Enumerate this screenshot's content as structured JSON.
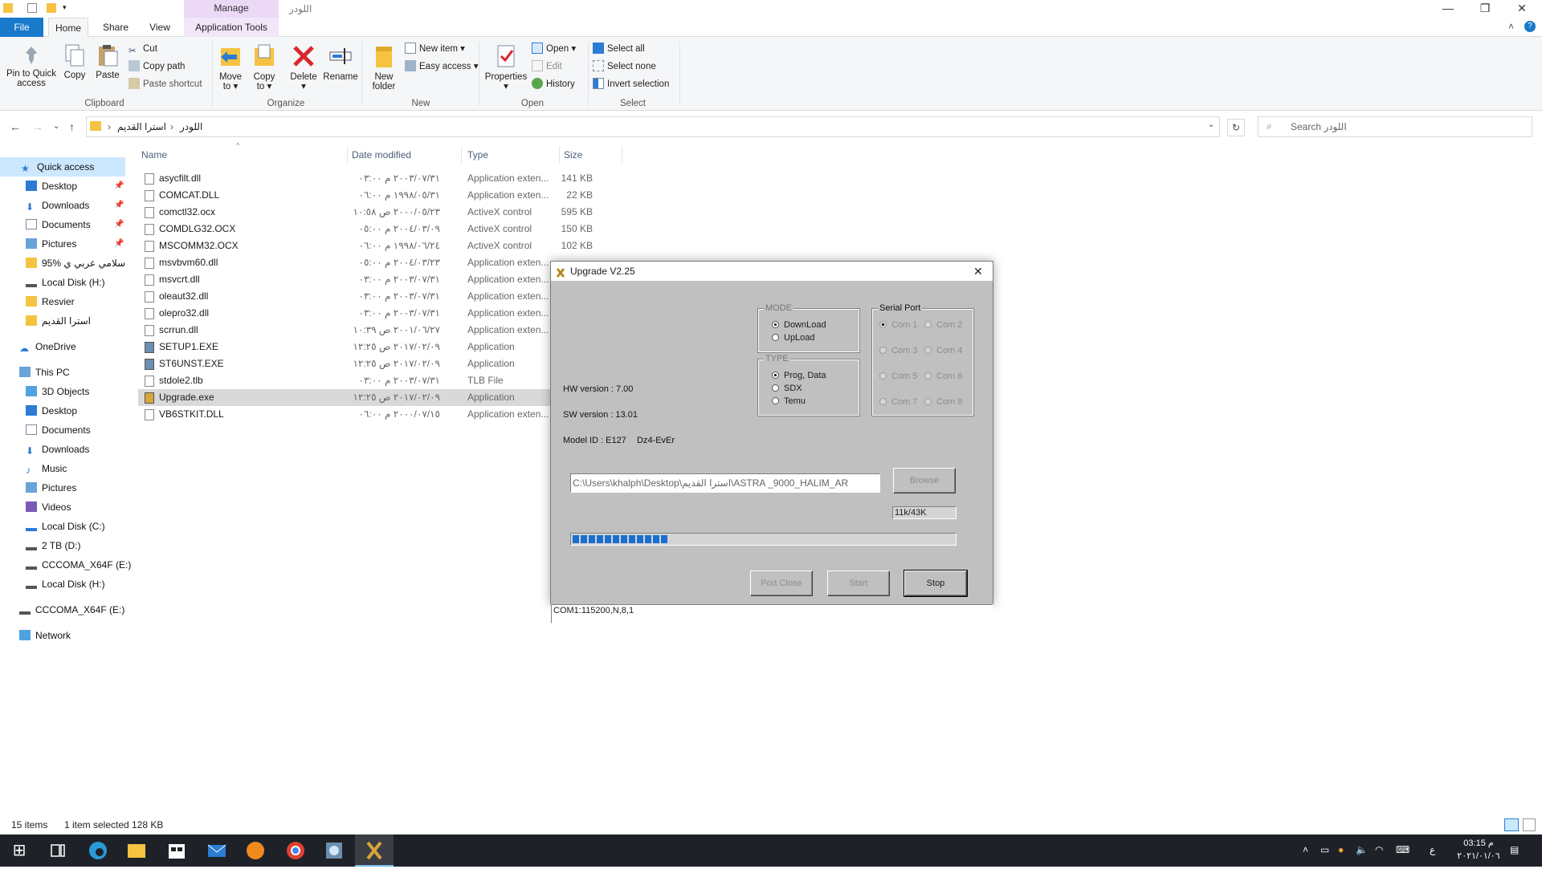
{
  "window": {
    "title": "اللودر",
    "manage_tab": "Manage",
    "controls": {
      "minimize": "—",
      "maximize": "❐",
      "close": "✕"
    }
  },
  "tabs": {
    "file": "File",
    "home": "Home",
    "share": "Share",
    "view": "View",
    "app_tools": "Application Tools",
    "right_chevron": "˄",
    "help": "?"
  },
  "ribbon": {
    "clipboard": {
      "pin": "Pin to Quick access",
      "copy": "Copy",
      "paste": "Paste",
      "cut": "Cut",
      "copy_path": "Copy path",
      "paste_shortcut": "Paste shortcut",
      "label": "Clipboard"
    },
    "organize": {
      "move_to": "Move to",
      "copy_to": "Copy to",
      "delete": "Delete",
      "rename": "Rename",
      "label": "Organize"
    },
    "new": {
      "new_folder": "New folder",
      "new_item": "New item",
      "easy_access": "Easy access",
      "label": "New"
    },
    "open": {
      "properties": "Properties",
      "open": "Open",
      "edit": "Edit",
      "history": "History",
      "label": "Open"
    },
    "select": {
      "select_all": "Select all",
      "select_none": "Select none",
      "invert": "Invert selection",
      "label": "Select"
    }
  },
  "address": {
    "path": [
      "استرا القديم",
      "اللودر"
    ],
    "search_placeholder": "Search اللودر"
  },
  "nav": {
    "quick_access": "Quick access",
    "items": [
      "Desktop",
      "Downloads",
      "Documents",
      "Pictures",
      "95% اسلامي عربي ي",
      "Local Disk (H:)",
      "Resvier",
      "استرا القديم"
    ],
    "onedrive": "OneDrive",
    "this_pc": "This PC",
    "pc_items": [
      "3D Objects",
      "Desktop",
      "Documents",
      "Downloads",
      "Music",
      "Pictures",
      "Videos",
      "Local Disk (C:)",
      "2 TB (D:)",
      "CCCOMA_X64F (E:)",
      "Local Disk (H:)"
    ],
    "drive_e": "CCCOMA_X64F (E:)",
    "network": "Network"
  },
  "columns": {
    "name": "Name",
    "date": "Date modified",
    "type": "Type",
    "size": "Size"
  },
  "files": [
    {
      "name": "asycfilt.dll",
      "date": "٢٠٠٣/٠٧/٣١ م ٠٣:٠٠",
      "type": "Application exten...",
      "size": "141 KB"
    },
    {
      "name": "COMCAT.DLL",
      "date": "١٩٩٨/٠٥/٣١ م ٠٦:٠٠",
      "type": "Application exten...",
      "size": "22 KB"
    },
    {
      "name": "comctl32.ocx",
      "date": "٢٠٠٠/٠٥/٢٣ ص ١٠:٥٨",
      "type": "ActiveX control",
      "size": "595 KB"
    },
    {
      "name": "COMDLG32.OCX",
      "date": "٢٠٠٤/٠٣/٠٩ م ٠٥:٠٠",
      "type": "ActiveX control",
      "size": "150 KB"
    },
    {
      "name": "MSCOMM32.OCX",
      "date": "١٩٩٨/٠٦/٢٤ م ٠٦:٠٠",
      "type": "ActiveX control",
      "size": "102 KB"
    },
    {
      "name": "msvbvm60.dll",
      "date": "٢٠٠٤/٠٣/٢٣ م ٠٥:٠٠",
      "type": "Application exten...",
      "size": ""
    },
    {
      "name": "msvcrt.dll",
      "date": "٢٠٠٣/٠٧/٣١ م ٠٣:٠٠",
      "type": "Application exten...",
      "size": ""
    },
    {
      "name": "oleaut32.dll",
      "date": "٢٠٠٣/٠٧/٣١ م ٠٣:٠٠",
      "type": "Application exten...",
      "size": ""
    },
    {
      "name": "olepro32.dll",
      "date": "٢٠٠٣/٠٧/٣١ م ٠٣:٠٠",
      "type": "Application exten...",
      "size": ""
    },
    {
      "name": "scrrun.dll",
      "date": "٢٠٠١/٠٦/٢٧ ص ١٠:٣٩",
      "type": "Application exten...",
      "size": ""
    },
    {
      "name": "SETUP1.EXE",
      "date": "٢٠١٧/٠٢/٠٩ ص ١٢:٢٥",
      "type": "Application",
      "size": ""
    },
    {
      "name": "ST6UNST.EXE",
      "date": "٢٠١٧/٠٢/٠٩ ص ١٢:٢٥",
      "type": "Application",
      "size": ""
    },
    {
      "name": "stdole2.tlb",
      "date": "٢٠٠٣/٠٧/٣١ م ٠٣:٠٠",
      "type": "TLB File",
      "size": ""
    },
    {
      "name": "Upgrade.exe",
      "date": "٢٠١٧/٠٢/٠٩ ص ١٢:٢٥",
      "type": "Application",
      "size": ""
    },
    {
      "name": "VB6STKIT.DLL",
      "date": "٢٠٠٠/٠٧/١٥ م ٠٦:٠٠",
      "type": "Application exten...",
      "size": ""
    }
  ],
  "status": {
    "items": "15 items",
    "selected": "1 item selected  128 KB"
  },
  "dialog": {
    "title": "Upgrade V2.25",
    "close": "✕",
    "mode_label": "MODE",
    "mode_options": [
      "DownLoad",
      "UpLoad"
    ],
    "type_label": "TYPE",
    "type_options": [
      "Prog, Data",
      "SDX",
      "Temu"
    ],
    "serial_label": "Serial Port",
    "com_ports": [
      "Com 1",
      "Com 2",
      "Com 3",
      "Com 4",
      "Com 5",
      "Com 6",
      "Com 7",
      "Com 8"
    ],
    "hw_version": "HW version : 7.00",
    "sw_version": "SW version : 13.01",
    "model_id": "Model ID : E127",
    "model_code": "Dz4-EvEr",
    "file_path": "C:\\Users\\khalph\\Desktop\\استرا القديم\\ASTRA _9000_HALIM_AR",
    "browse": "Browse",
    "counter": "11k/43K",
    "progress": 0.26,
    "port_close": "Port Close",
    "start": "Start",
    "stop": "Stop",
    "status_line": "COM1:115200,N,8,1"
  },
  "taskbar": {
    "start": "⊞",
    "time": "03:15 م",
    "date": "٢٠٢١/٠١/٠٦",
    "lang": "ع"
  }
}
